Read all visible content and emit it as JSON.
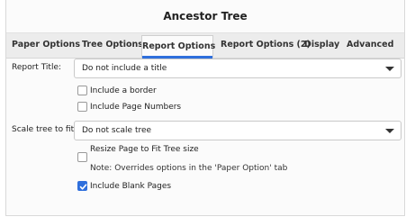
{
  "window": {
    "title": "Ancestor Tree"
  },
  "tabs": [
    {
      "label": "Paper Options",
      "active": false
    },
    {
      "label": "Tree Options",
      "active": false
    },
    {
      "label": "Report Options",
      "active": true
    },
    {
      "label": "Report Options (2)",
      "active": false
    },
    {
      "label": "Display",
      "active": false
    },
    {
      "label": "Advanced",
      "active": false
    }
  ],
  "report_title": {
    "label": "Report Title:",
    "value": "Do not include a title"
  },
  "options": {
    "include_border": {
      "label": "Include a border",
      "checked": false
    },
    "include_page_numbers": {
      "label": "Include Page Numbers",
      "checked": false
    }
  },
  "scale": {
    "label": "Scale tree to fit:",
    "value": "Do not scale tree"
  },
  "resize": {
    "label": "Resize Page to Fit Tree size",
    "note": "Note: Overrides options in the 'Paper Option' tab",
    "checked": false
  },
  "blank_pages": {
    "label": "Include Blank Pages",
    "checked": true
  },
  "colors": {
    "accent": "#2f6fdc"
  }
}
